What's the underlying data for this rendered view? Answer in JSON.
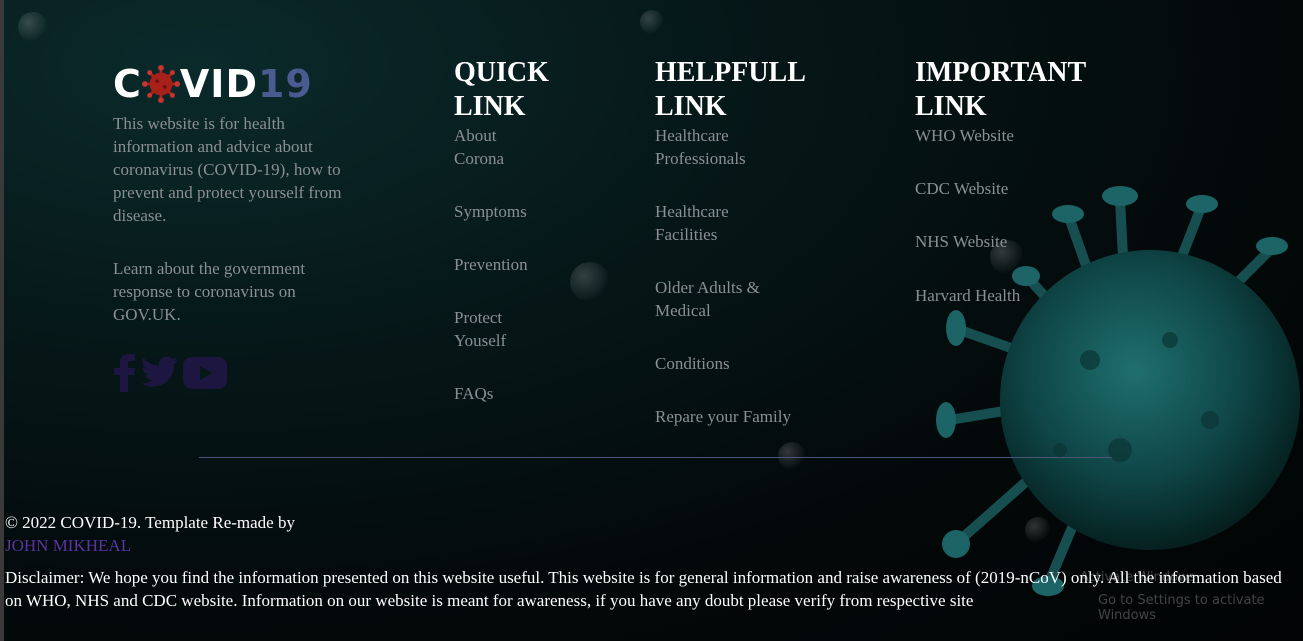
{
  "brand": {
    "part1": "C",
    "part2": "VID",
    "part3": "19"
  },
  "about": {
    "description": "This website is for health information and advice about coronavirus (COVID-19), how to prevent and protect yourself from disease.",
    "gov": "Learn about the government response to coronavirus on GOV.UK."
  },
  "social": [
    {
      "name": "facebook-icon"
    },
    {
      "name": "twitter-icon"
    },
    {
      "name": "youtube-icon"
    }
  ],
  "quick": {
    "title": "QUICK LINK",
    "links": [
      "About Corona",
      "Symptoms",
      "Prevention",
      "Protect Youself",
      "FAQs"
    ]
  },
  "helpful": {
    "title": "HELPFULL LINK",
    "links": [
      "Healthcare Professionals",
      "Healthcare Facilities",
      "Older Adults & Medical",
      "Conditions",
      "Repare your Family"
    ]
  },
  "important": {
    "title": "IMPORTANT LINK",
    "links": [
      "WHO Website",
      "CDC Website",
      "NHS Website",
      "Harvard Health"
    ]
  },
  "footer": {
    "copyright": "© 2022 COVID-19. Template Re-made by",
    "author": "JOHN MIKHEAL",
    "disclaimer": "Disclaimer: We hope you find the information presented on this website useful. This website is for general information and raise awareness of (2019-nCoV) only. All the information based on WHO, NHS and CDC website. Information on our website is meant for awareness, if you have any doubt please verify from respective site"
  },
  "watermark": {
    "line1": "Activate Windows",
    "line2": "Go to Settings to activate Windows"
  },
  "colors": {
    "accent_blue": "#4a5b92",
    "virus_red": "#a8201a",
    "link_gray": "#8a8f94",
    "author_purple": "#5a34a0"
  }
}
